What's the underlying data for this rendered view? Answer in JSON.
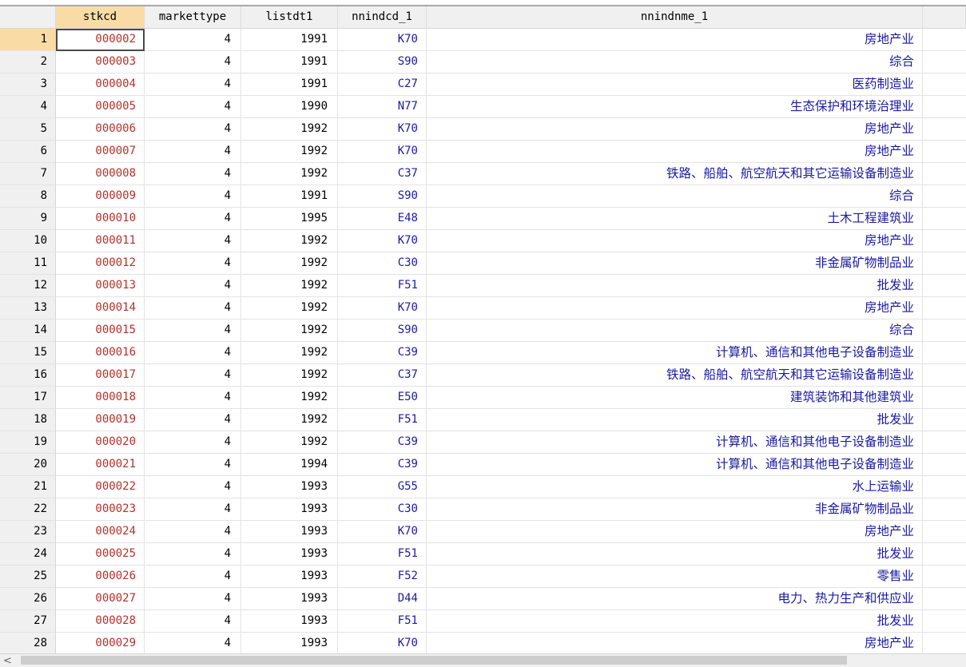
{
  "columns": [
    "stkcd",
    "markettype",
    "listdt1",
    "nnindcd_1",
    "nnindnme_1"
  ],
  "rows": [
    {
      "n": "1",
      "stkcd": "000002",
      "markettype": "4",
      "listdt1": "1991",
      "nnindcd_1": "K70",
      "nnindnme_1": "房地产业"
    },
    {
      "n": "2",
      "stkcd": "000003",
      "markettype": "4",
      "listdt1": "1991",
      "nnindcd_1": "S90",
      "nnindnme_1": "综合"
    },
    {
      "n": "3",
      "stkcd": "000004",
      "markettype": "4",
      "listdt1": "1991",
      "nnindcd_1": "C27",
      "nnindnme_1": "医药制造业"
    },
    {
      "n": "4",
      "stkcd": "000005",
      "markettype": "4",
      "listdt1": "1990",
      "nnindcd_1": "N77",
      "nnindnme_1": "生态保护和环境治理业"
    },
    {
      "n": "5",
      "stkcd": "000006",
      "markettype": "4",
      "listdt1": "1992",
      "nnindcd_1": "K70",
      "nnindnme_1": "房地产业"
    },
    {
      "n": "6",
      "stkcd": "000007",
      "markettype": "4",
      "listdt1": "1992",
      "nnindcd_1": "K70",
      "nnindnme_1": "房地产业"
    },
    {
      "n": "7",
      "stkcd": "000008",
      "markettype": "4",
      "listdt1": "1992",
      "nnindcd_1": "C37",
      "nnindnme_1": "铁路、船舶、航空航天和其它运输设备制造业"
    },
    {
      "n": "8",
      "stkcd": "000009",
      "markettype": "4",
      "listdt1": "1991",
      "nnindcd_1": "S90",
      "nnindnme_1": "综合"
    },
    {
      "n": "9",
      "stkcd": "000010",
      "markettype": "4",
      "listdt1": "1995",
      "nnindcd_1": "E48",
      "nnindnme_1": "土木工程建筑业"
    },
    {
      "n": "10",
      "stkcd": "000011",
      "markettype": "4",
      "listdt1": "1992",
      "nnindcd_1": "K70",
      "nnindnme_1": "房地产业"
    },
    {
      "n": "11",
      "stkcd": "000012",
      "markettype": "4",
      "listdt1": "1992",
      "nnindcd_1": "C30",
      "nnindnme_1": "非金属矿物制品业"
    },
    {
      "n": "12",
      "stkcd": "000013",
      "markettype": "4",
      "listdt1": "1992",
      "nnindcd_1": "F51",
      "nnindnme_1": "批发业"
    },
    {
      "n": "13",
      "stkcd": "000014",
      "markettype": "4",
      "listdt1": "1992",
      "nnindcd_1": "K70",
      "nnindnme_1": "房地产业"
    },
    {
      "n": "14",
      "stkcd": "000015",
      "markettype": "4",
      "listdt1": "1992",
      "nnindcd_1": "S90",
      "nnindnme_1": "综合"
    },
    {
      "n": "15",
      "stkcd": "000016",
      "markettype": "4",
      "listdt1": "1992",
      "nnindcd_1": "C39",
      "nnindnme_1": "计算机、通信和其他电子设备制造业"
    },
    {
      "n": "16",
      "stkcd": "000017",
      "markettype": "4",
      "listdt1": "1992",
      "nnindcd_1": "C37",
      "nnindnme_1": "铁路、船舶、航空航天和其它运输设备制造业"
    },
    {
      "n": "17",
      "stkcd": "000018",
      "markettype": "4",
      "listdt1": "1992",
      "nnindcd_1": "E50",
      "nnindnme_1": "建筑装饰和其他建筑业"
    },
    {
      "n": "18",
      "stkcd": "000019",
      "markettype": "4",
      "listdt1": "1992",
      "nnindcd_1": "F51",
      "nnindnme_1": "批发业"
    },
    {
      "n": "19",
      "stkcd": "000020",
      "markettype": "4",
      "listdt1": "1992",
      "nnindcd_1": "C39",
      "nnindnme_1": "计算机、通信和其他电子设备制造业"
    },
    {
      "n": "20",
      "stkcd": "000021",
      "markettype": "4",
      "listdt1": "1994",
      "nnindcd_1": "C39",
      "nnindnme_1": "计算机、通信和其他电子设备制造业"
    },
    {
      "n": "21",
      "stkcd": "000022",
      "markettype": "4",
      "listdt1": "1993",
      "nnindcd_1": "G55",
      "nnindnme_1": "水上运输业"
    },
    {
      "n": "22",
      "stkcd": "000023",
      "markettype": "4",
      "listdt1": "1993",
      "nnindcd_1": "C30",
      "nnindnme_1": "非金属矿物制品业"
    },
    {
      "n": "23",
      "stkcd": "000024",
      "markettype": "4",
      "listdt1": "1993",
      "nnindcd_1": "K70",
      "nnindnme_1": "房地产业"
    },
    {
      "n": "24",
      "stkcd": "000025",
      "markettype": "4",
      "listdt1": "1993",
      "nnindcd_1": "F51",
      "nnindnme_1": "批发业"
    },
    {
      "n": "25",
      "stkcd": "000026",
      "markettype": "4",
      "listdt1": "1993",
      "nnindcd_1": "F52",
      "nnindnme_1": "零售业"
    },
    {
      "n": "26",
      "stkcd": "000027",
      "markettype": "4",
      "listdt1": "1993",
      "nnindcd_1": "D44",
      "nnindnme_1": "电力、热力生产和供应业"
    },
    {
      "n": "27",
      "stkcd": "000028",
      "markettype": "4",
      "listdt1": "1993",
      "nnindcd_1": "F51",
      "nnindnme_1": "批发业"
    },
    {
      "n": "28",
      "stkcd": "000029",
      "markettype": "4",
      "listdt1": "1993",
      "nnindcd_1": "K70",
      "nnindnme_1": "房地产业"
    }
  ],
  "scrollbar": {
    "left_arrow": "<"
  },
  "colors": {
    "string_value": "#b2322b",
    "label_value": "#1a1aa0",
    "selected_header": "#f9dca5",
    "header_bg": "#f0f0f0"
  },
  "icons": [
    "scroll-left-arrow-icon"
  ]
}
